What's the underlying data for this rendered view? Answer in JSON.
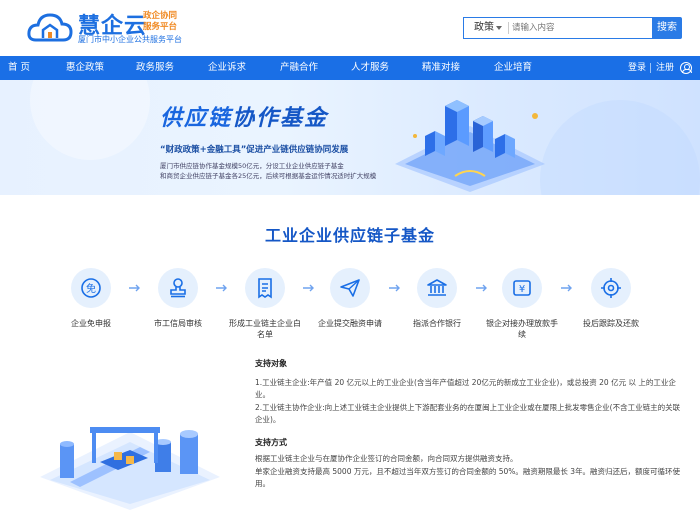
{
  "brand": {
    "name": "慧企云",
    "tagline_1": "政企协同",
    "tagline_2": "服务平台",
    "description": "厦门市中小企业公共服务平台"
  },
  "search": {
    "category": "政策",
    "placeholder": "请输入内容",
    "button": "搜索"
  },
  "nav": {
    "items": [
      "首 页",
      "惠企政策",
      "政务服务",
      "企业诉求",
      "产融合作",
      "人才服务",
      "精准对接",
      "企业培育"
    ],
    "login": "登录",
    "register": "注册"
  },
  "banner": {
    "title_part1": "供应链",
    "title_part2": "协作基金",
    "slogan": "“财政政策+金融工具”促进产业链供应链协同发展",
    "line1": "厦门市供应链协作基金规模50亿元，分设工业企业供应链子基金",
    "line2": "和商贸企业供应链子基金各25亿元，后续可根据基金运作情况适时扩大规模"
  },
  "section": {
    "title": "工业企业供应链子基金"
  },
  "steps": [
    {
      "label": "企业免申报",
      "icon": "exempt-icon"
    },
    {
      "label": "市工信局审核",
      "icon": "stamp-icon"
    },
    {
      "label": "形成工业链主企业白名单",
      "icon": "document-list-icon"
    },
    {
      "label": "企业提交融资申请",
      "icon": "paper-plane-icon"
    },
    {
      "label": "指派合作银行",
      "icon": "bank-icon"
    },
    {
      "label": "银企对接办理放款手续",
      "icon": "money-icon"
    },
    {
      "label": "投后跟踪及还款",
      "icon": "target-icon"
    }
  ],
  "support": {
    "target_heading": "支持对象",
    "target_1": "1.工业链主企业:年产值 20 亿元以上的工业企业(含当年产值超过 20亿元的新成立工业企业)，或总投资 20 亿元 以 上的工业企业。",
    "target_2": "2.工业链主协作企业:向上述工业链主企业提供上下游配套业务的在厦闽上工业企业或在厦限上批发零售企业(不含工业链主的关联企业)。",
    "method_heading": "支持方式",
    "method_1": "根据工业链主企业与在厦协作企业签订的合同金额，向合同双方提供融资支持。",
    "method_2": "单家企业融资支持最高 5000 万元，且不超过当年双方签订的合同金额的 50%。融资期限最长 3年。融资归还后，额度可循环使用。"
  },
  "colors": {
    "primary": "#1a6fe6",
    "brand_orange": "#f08a24",
    "title_blue": "#1557c6",
    "step_bg": "#e5f0fd"
  }
}
